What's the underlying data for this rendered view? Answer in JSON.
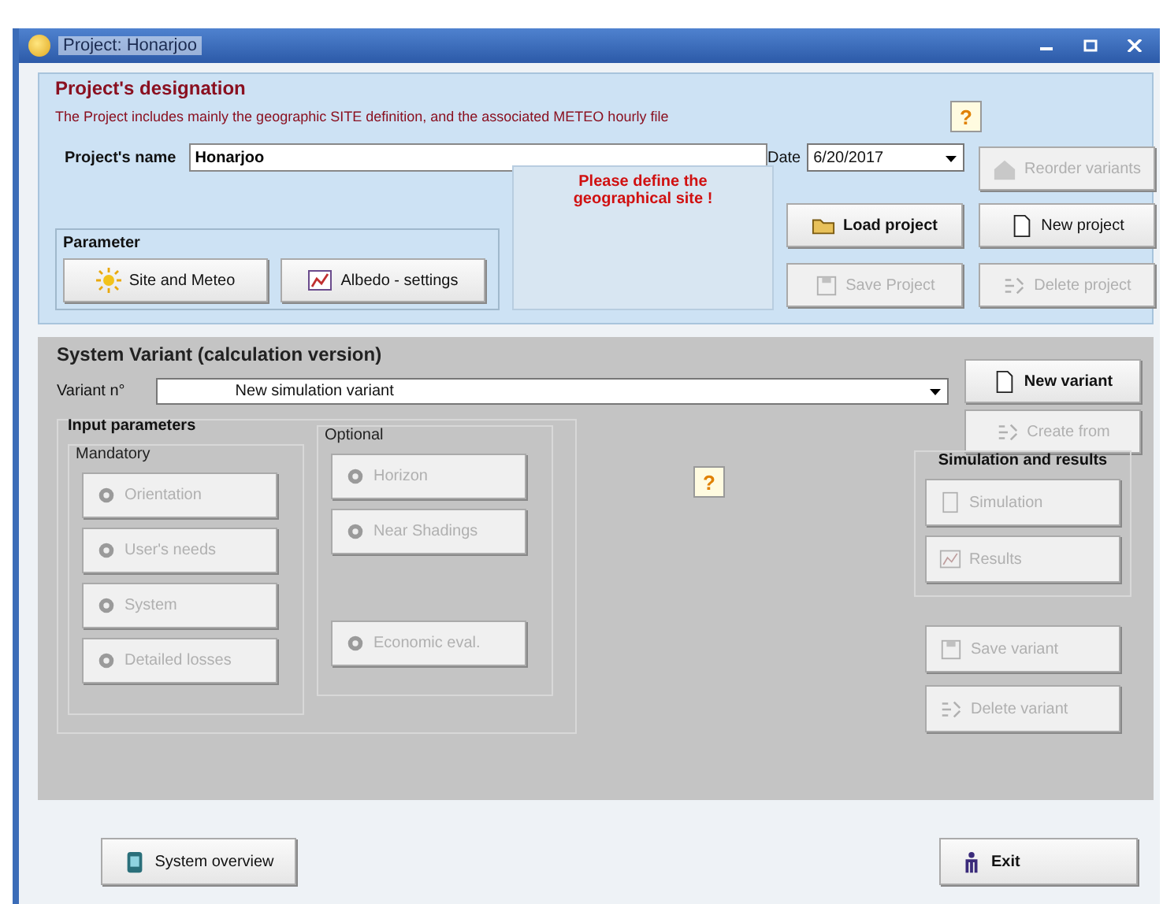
{
  "window": {
    "title": "Project: Honarjoo"
  },
  "project": {
    "heading": "Project's designation",
    "description": "The Project includes mainly the geographic SITE definition, and the associated METEO hourly file",
    "help": "?",
    "name_label": "Project's name",
    "name_value": "Honarjoo",
    "date_label": "Date",
    "date_value": "6/20/2017",
    "message": "Please define the geographical site !",
    "parameter": {
      "heading": "Parameter",
      "buttons": [
        {
          "label": "Site and Meteo",
          "disabled": false
        },
        {
          "label": "Albedo - settings",
          "disabled": false
        }
      ]
    },
    "buttons": [
      {
        "label": "Reorder variants",
        "disabled": true
      },
      {
        "label": "Load project",
        "disabled": false
      },
      {
        "label": "New project",
        "disabled": false
      },
      {
        "label": "Save Project",
        "disabled": true
      },
      {
        "label": "Delete project",
        "disabled": true
      }
    ]
  },
  "variant": {
    "heading": "System Variant (calculation version)",
    "variant_label": "Variant n°",
    "variant_value": "New simulation variant",
    "buttons": [
      {
        "label": "New variant",
        "disabled": false
      },
      {
        "label": "Create from",
        "disabled": true
      }
    ],
    "help": "?",
    "input": {
      "heading": "Input parameters",
      "mandatory": {
        "heading": "Mandatory",
        "buttons": [
          {
            "label": "Orientation",
            "disabled": true
          },
          {
            "label": "User's needs",
            "disabled": true
          },
          {
            "label": "System",
            "disabled": true
          },
          {
            "label": "Detailed losses",
            "disabled": true
          }
        ]
      },
      "optional": {
        "heading": "Optional",
        "buttons": [
          {
            "label": "Horizon",
            "disabled": true
          },
          {
            "label": "Near Shadings",
            "disabled": true
          },
          {
            "label": "Economic eval.",
            "disabled": true
          }
        ]
      }
    },
    "simulation": {
      "heading": "Simulation and results",
      "buttons": [
        {
          "label": "Simulation",
          "disabled": true
        },
        {
          "label": "Results",
          "disabled": true
        }
      ]
    },
    "actions": [
      {
        "label": "Save variant",
        "disabled": true
      },
      {
        "label": "Delete variant",
        "disabled": true
      }
    ]
  },
  "footer": {
    "buttons": [
      {
        "label": "System overview",
        "disabled": false
      },
      {
        "label": "Exit",
        "disabled": false
      }
    ]
  }
}
